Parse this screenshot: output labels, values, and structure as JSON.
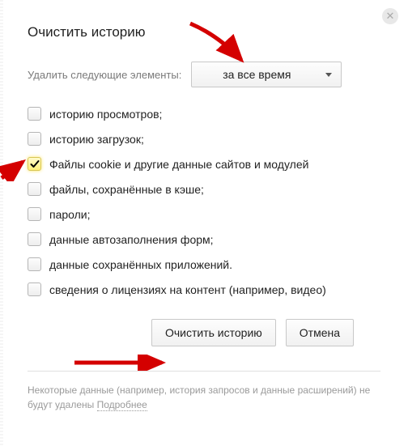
{
  "dialog": {
    "title": "Очистить историю",
    "close_icon": "✕",
    "time_label": "Удалить следующие элементы:",
    "time_value": "за все время",
    "options": [
      {
        "label": "историю просмотров;",
        "checked": false
      },
      {
        "label": "историю загрузок;",
        "checked": false
      },
      {
        "label": "Файлы cookie и другие данные сайтов и модулей",
        "checked": true
      },
      {
        "label": "файлы, сохранённые в кэше;",
        "checked": false
      },
      {
        "label": "пароли;",
        "checked": false
      },
      {
        "label": "данные автозаполнения форм;",
        "checked": false
      },
      {
        "label": "данные сохранённых приложений.",
        "checked": false
      },
      {
        "label": "сведения о лицензиях на контент (например, видео)",
        "checked": false
      }
    ],
    "buttons": {
      "clear": "Очистить историю",
      "cancel": "Отмена"
    },
    "footer_text": "Некоторые данные (например, история запросов и данные расширений) не будут удалены ",
    "footer_link": "Подробнее"
  }
}
